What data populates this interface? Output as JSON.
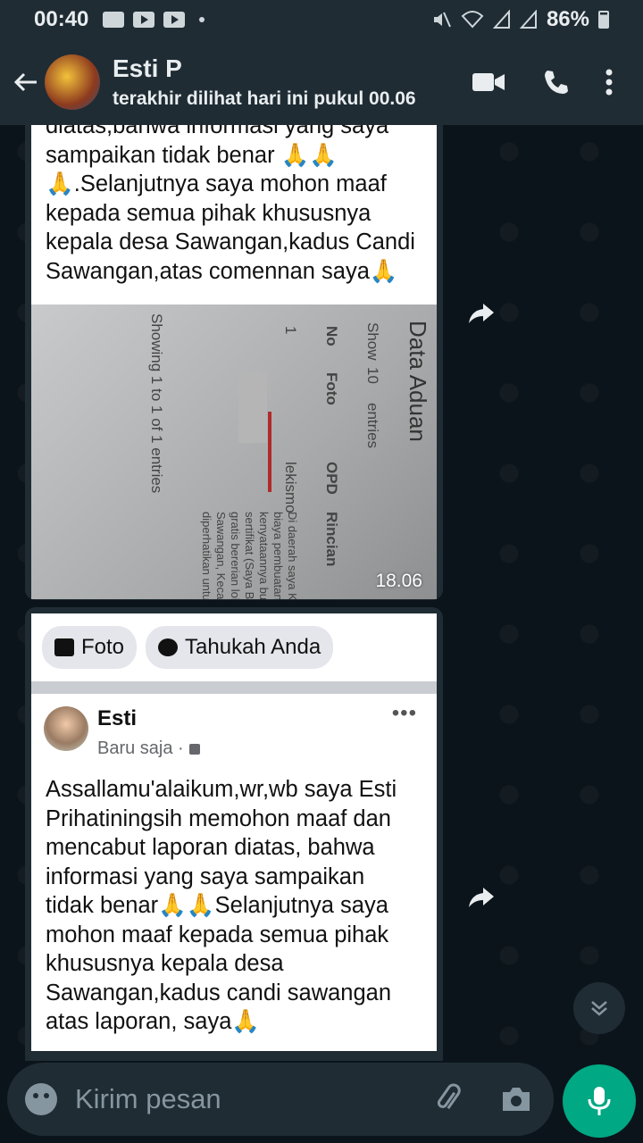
{
  "status_bar": {
    "time": "00:40",
    "battery": "86%"
  },
  "header": {
    "contact_name": "Esti P",
    "last_seen": "terakhir dilihat hari ini pukul 00.06",
    "icons": [
      "back-arrow-icon",
      "video-call-icon",
      "phone-icon",
      "more-vert-icon"
    ]
  },
  "messages": [
    {
      "caption_lines": [
        "diatas,bahwa informasi yang saya",
        "sampaikan tidak benar 🙏🙏",
        "🙏.Selanjutnya saya mohon maaf",
        "kepada semua pihak khususnya",
        "kepala desa Sawangan,kadus Candi",
        "Sawangan,atas comennan saya🙏"
      ],
      "photo": {
        "title": "Data Aduan",
        "show": "Show",
        "entries_count": "10",
        "entries": "entries",
        "col_no": "No",
        "col_foto": "Foto",
        "col_opd": "OPD",
        "col_rincian": "Rincian",
        "row_no": "1",
        "row_opd": "lekismo",
        "footer": "Showing 1 to 1 of 1 entries",
        "rincian_lines": [
          "Di daerah saya Kecamat",
          "biaya pembuatan se",
          "kenyataannya bukan",
          "sertifikat (Saya Baya",
          "gratis bererian loh P",
          "Sawangan, Kecamat",
          "diperhatikan untuk g"
        ]
      },
      "time": "18.06"
    },
    {
      "chips": [
        {
          "label": "Foto",
          "icon": "photo-icon"
        },
        {
          "label": "Tahukah Anda",
          "icon": "speech-bubble-icon"
        }
      ],
      "post": {
        "author": "Esti",
        "time": "Baru saja ·",
        "more": "•••",
        "body_lines": [
          "Assallamu'alaikum,wr,wb saya Esti",
          "Prihatiningsih memohon maaf dan",
          "mencabut laporan diatas, bahwa",
          "informasi yang saya sampaikan",
          "tidak benar🙏🙏Selanjutnya saya",
          "mohon maaf kepada semua pihak",
          "khususnya kepala desa",
          "Sawangan,kadus candi sawangan",
          "atas laporan, saya🙏"
        ]
      }
    }
  ],
  "input": {
    "placeholder": "Kirim pesan"
  },
  "colors": {
    "header_bg": "#1f2c34",
    "chat_bg": "#0b141a",
    "mic_button": "#00a884"
  }
}
